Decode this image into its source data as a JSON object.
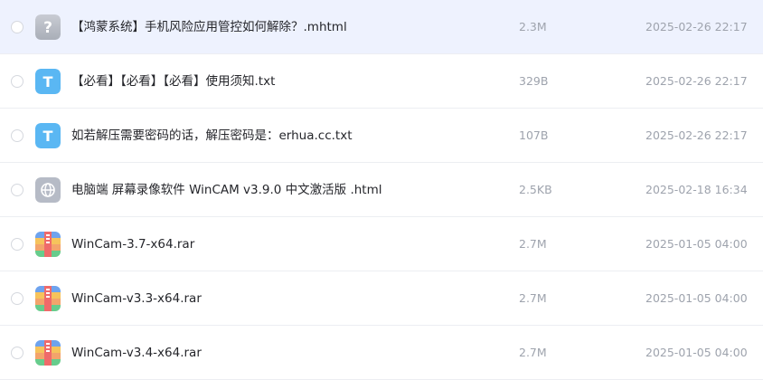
{
  "files": [
    {
      "name": "【鸿蒙系统】手机风险应用管控如何解除？.mhtml",
      "size": "2.3M",
      "date": "2025-02-26 22:17",
      "icon": "unknown-file-icon",
      "selected": true
    },
    {
      "name": "【必看】【必看】【必看】使用须知.txt",
      "size": "329B",
      "date": "2025-02-26 22:17",
      "icon": "text-file-icon",
      "selected": false
    },
    {
      "name": "如若解压需要密码的话，解压密码是：erhua.cc.txt",
      "size": "107B",
      "date": "2025-02-26 22:17",
      "icon": "text-file-icon",
      "selected": false
    },
    {
      "name": "电脑端 屏幕录像软件 WinCAM v3.9.0 中文激活版 .html",
      "size": "2.5KB",
      "date": "2025-02-18 16:34",
      "icon": "web-file-icon",
      "selected": false
    },
    {
      "name": "WinCam-3.7-x64.rar",
      "size": "2.7M",
      "date": "2025-01-05 04:00",
      "icon": "archive-file-icon",
      "selected": false
    },
    {
      "name": "WinCam-v3.3-x64.rar",
      "size": "2.7M",
      "date": "2025-01-05 04:00",
      "icon": "archive-file-icon",
      "selected": false
    },
    {
      "name": "WinCam-v3.4-x64.rar",
      "size": "2.7M",
      "date": "2025-01-05 04:00",
      "icon": "archive-file-icon",
      "selected": false
    }
  ],
  "icon_glyphs": {
    "unknown": "?",
    "text": "T"
  },
  "colors": {
    "selected_row": "#eef2fe",
    "text_icon": "#5ab7f3",
    "unknown_icon": "#b9bdc6",
    "web_icon": "#b6bbc6"
  }
}
